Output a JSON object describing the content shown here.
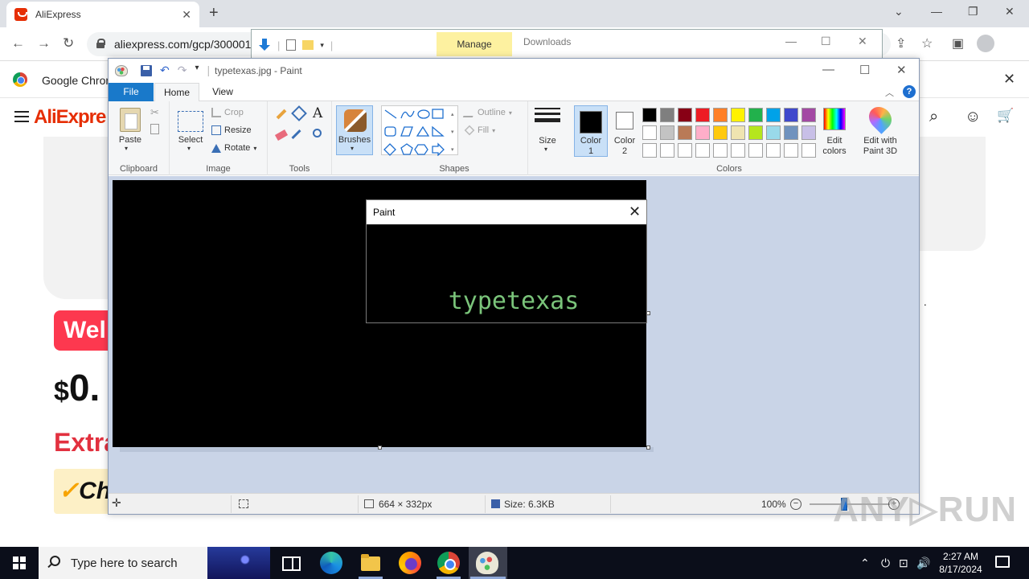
{
  "chrome": {
    "tab_title": "AliExpress",
    "tab_close": "✕",
    "new_tab": "+",
    "url": "aliexpress.com/gcp/3000015",
    "bookmark_label": "Google Chrom",
    "bookmark_close": "✕",
    "controls": {
      "chevron": "⌄",
      "minimize": "—",
      "restore": "❐",
      "close": "✕"
    },
    "nav": {
      "back": "←",
      "forward": "→",
      "reload": "↻"
    },
    "addr_icons": {
      "share": "⇪",
      "star": "☆",
      "sidepanel": "▣"
    }
  },
  "aliexpress": {
    "logo": "AliExpre",
    "welcome": "Wel",
    "price_currency": "$",
    "price_value": "0.",
    "extra": "Extra",
    "choice_check": "✓",
    "choice": "Ch",
    "icons": {
      "search": "⌕",
      "account": "☺",
      "cart": "🛒"
    },
    "dots": "· ·"
  },
  "explorer": {
    "manage_tab": "Manage",
    "title": "Downloads",
    "controls": {
      "minimize": "—",
      "maximize": "☐",
      "close": "✕"
    }
  },
  "paint": {
    "window_title": "typetexas.jpg - Paint",
    "controls": {
      "minimize": "—",
      "maximize": "☐",
      "close": "✕"
    },
    "tabs": {
      "file": "File",
      "home": "Home",
      "view": "View"
    },
    "ribbon": {
      "clipboard": {
        "paste": "Paste",
        "group": "Clipboard"
      },
      "image": {
        "select": "Select",
        "crop": "Crop",
        "resize": "Resize",
        "rotate": "Rotate",
        "group": "Image"
      },
      "tools": {
        "group": "Tools",
        "text_tool": "A"
      },
      "brushes": "Brushes",
      "shapes": {
        "outline": "Outline",
        "fill": "Fill",
        "group": "Shapes"
      },
      "size": "Size",
      "colors": {
        "color1": "Color",
        "color1_n": "1",
        "color2": "Color",
        "color2_n": "2",
        "group": "Colors",
        "edit_colors_1": "Edit",
        "edit_colors_2": "colors",
        "paint3d_1": "Edit with",
        "paint3d_2": "Paint 3D"
      },
      "palette": [
        "#000000",
        "#7f7f7f",
        "#880015",
        "#ed1c24",
        "#ff7f27",
        "#fff200",
        "#22b14c",
        "#00a2e8",
        "#3f48cc",
        "#a349a4",
        "#ffffff",
        "#c3c3c3",
        "#b97a57",
        "#ffaec9",
        "#ffc90e",
        "#efe4b0",
        "#b5e61d",
        "#99d9ea",
        "#7092be",
        "#c8bfe7",
        "#ffffff",
        "#ffffff",
        "#ffffff",
        "#ffffff",
        "#ffffff",
        "#ffffff",
        "#ffffff",
        "#ffffff",
        "#ffffff",
        "#ffffff"
      ]
    },
    "status": {
      "dimensions": "664 × 332px",
      "file_size": "Size: 6.3KB",
      "zoom": "100%"
    },
    "dialog": {
      "title": "Paint",
      "close": "✕",
      "message": "typetexas"
    }
  },
  "watermark": "ANY▷RUN",
  "taskbar": {
    "search_placeholder": "Type here to search",
    "time": "2:27 AM",
    "date": "8/17/2024",
    "tray": {
      "chevron": "⌃",
      "network": "⊡",
      "volume": "🔊"
    }
  }
}
